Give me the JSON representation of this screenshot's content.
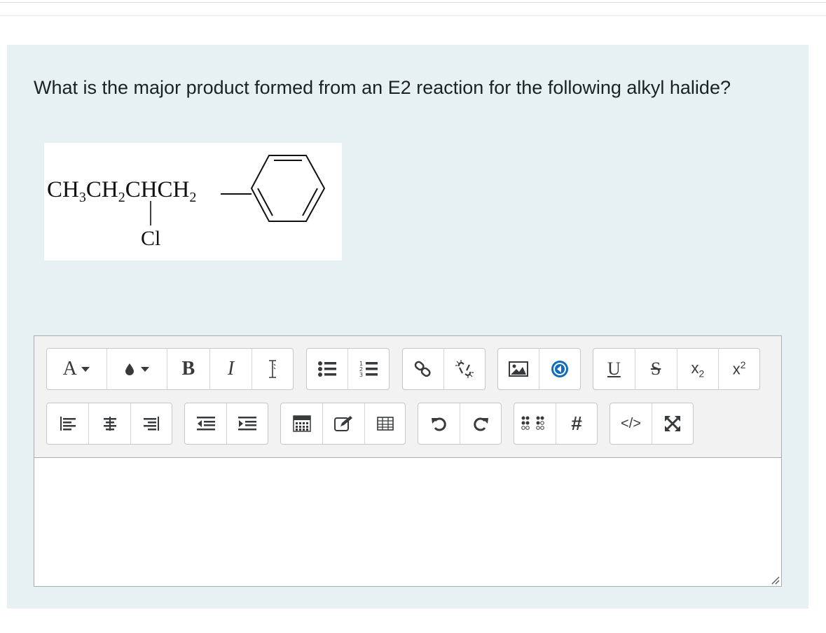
{
  "question": {
    "text": "What is the major product formed from an E2 reaction for the following alkyl halide?"
  },
  "structure": {
    "chain_parts": [
      "CH",
      "3",
      "CH",
      "2",
      "CHCH",
      "2"
    ],
    "substituent": "Cl"
  },
  "editor": {
    "row1": [
      {
        "name": "font-color-button",
        "label": "A",
        "icon": "font-color-icon"
      },
      {
        "name": "background-color-button",
        "icon": "drop-icon"
      },
      {
        "name": "bold-button",
        "label": "B",
        "icon": "bold-icon"
      },
      {
        "name": "italic-button",
        "label": "I",
        "icon": "italic-icon"
      },
      {
        "name": "clear-formatting-button",
        "label": "I",
        "icon": "clear-format-icon"
      },
      {
        "name": "unordered-list-button",
        "icon": "bullet-list-icon"
      },
      {
        "name": "ordered-list-button",
        "icon": "numbered-list-icon"
      },
      {
        "name": "link-button",
        "icon": "link-icon"
      },
      {
        "name": "unlink-button",
        "icon": "unlink-icon"
      },
      {
        "name": "insert-image-button",
        "icon": "image-icon"
      },
      {
        "name": "insert-media-button",
        "icon": "media-icon"
      },
      {
        "name": "underline-button",
        "label": "U",
        "icon": "underline-icon"
      },
      {
        "name": "strikethrough-button",
        "label": "S",
        "icon": "strikethrough-icon"
      },
      {
        "name": "subscript-button",
        "label": "x",
        "sub": "2",
        "icon": "subscript-icon"
      },
      {
        "name": "superscript-button",
        "label": "x",
        "sup": "2",
        "icon": "superscript-icon"
      }
    ],
    "row2": [
      {
        "name": "align-left-button",
        "icon": "align-left-icon"
      },
      {
        "name": "align-center-button",
        "icon": "align-center-icon"
      },
      {
        "name": "align-right-button",
        "icon": "align-right-icon"
      },
      {
        "name": "outdent-button",
        "icon": "outdent-icon"
      },
      {
        "name": "indent-button",
        "icon": "indent-icon"
      },
      {
        "name": "equation-button",
        "icon": "calculator-icon"
      },
      {
        "name": "edit-button",
        "icon": "pencil-icon"
      },
      {
        "name": "table-button",
        "icon": "table-icon"
      },
      {
        "name": "undo-button",
        "icon": "undo-icon"
      },
      {
        "name": "redo-button",
        "icon": "redo-icon"
      },
      {
        "name": "accessibility-checker-button",
        "icon": "braille-icon"
      },
      {
        "name": "special-character-button",
        "label": "#",
        "icon": "hash-icon"
      },
      {
        "name": "html-button",
        "label": "</>",
        "icon": "code-icon"
      },
      {
        "name": "fullscreen-button",
        "icon": "expand-icon"
      }
    ],
    "content": ""
  },
  "colors": {
    "panel_bg": "#e7f1f4",
    "toolbar_bg": "#f2f2f2",
    "icon": "#373a3c",
    "accent_blue": "#0f6cbf"
  }
}
